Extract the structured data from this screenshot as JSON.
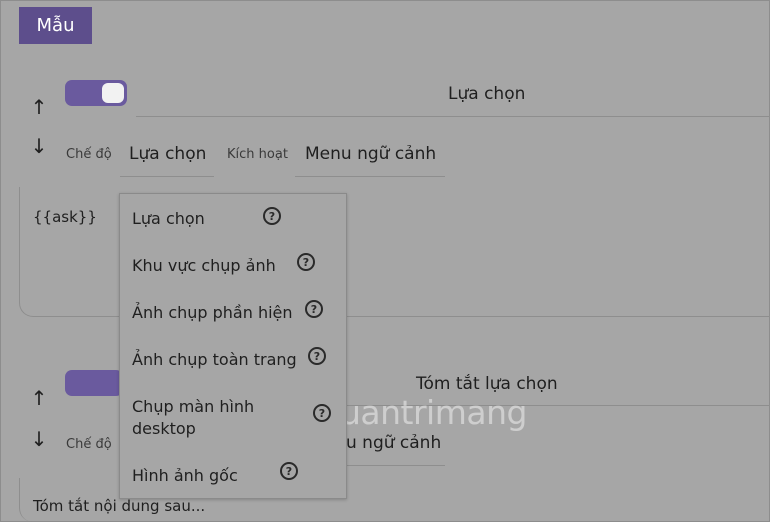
{
  "header": {
    "badge": "Mẫu"
  },
  "section1": {
    "up_arrow": "↑",
    "down_arrow": "↓",
    "title": "Lựa chọn",
    "mode_label": "Chế độ",
    "mode_value": "Lựa chọn",
    "trigger_label": "Kích hoạt",
    "trigger_value": "Menu ngữ cảnh",
    "content": "{{ask}}"
  },
  "section2": {
    "up_arrow": "↑",
    "down_arrow": "↓",
    "title": "Tóm tắt lựa chọn",
    "mode_label": "Chế độ",
    "trigger_value_partial": "u ngữ cảnh",
    "content": "Tóm tắt nội dung sau..."
  },
  "menu": {
    "items": [
      {
        "label": "Lựa chọn",
        "icon": "help-icon"
      },
      {
        "label": "Khu vực chụp ảnh",
        "icon": "help-icon"
      },
      {
        "label": "Ảnh chụp phần hiện",
        "icon": "help-icon"
      },
      {
        "label": "Ảnh chụp toàn trang",
        "icon": "help-icon"
      },
      {
        "label_line1": "Chụp màn hình",
        "label_line2": "desktop",
        "icon": "help-icon"
      },
      {
        "label": "Hình ảnh gốc",
        "icon": "help-icon"
      }
    ],
    "help_glyph": "?"
  },
  "watermark": {
    "text": "uantrimang"
  },
  "colors": {
    "accent": "#5d4e8c",
    "toggle": "#6a5a9e",
    "background": "#a6a6a6"
  }
}
